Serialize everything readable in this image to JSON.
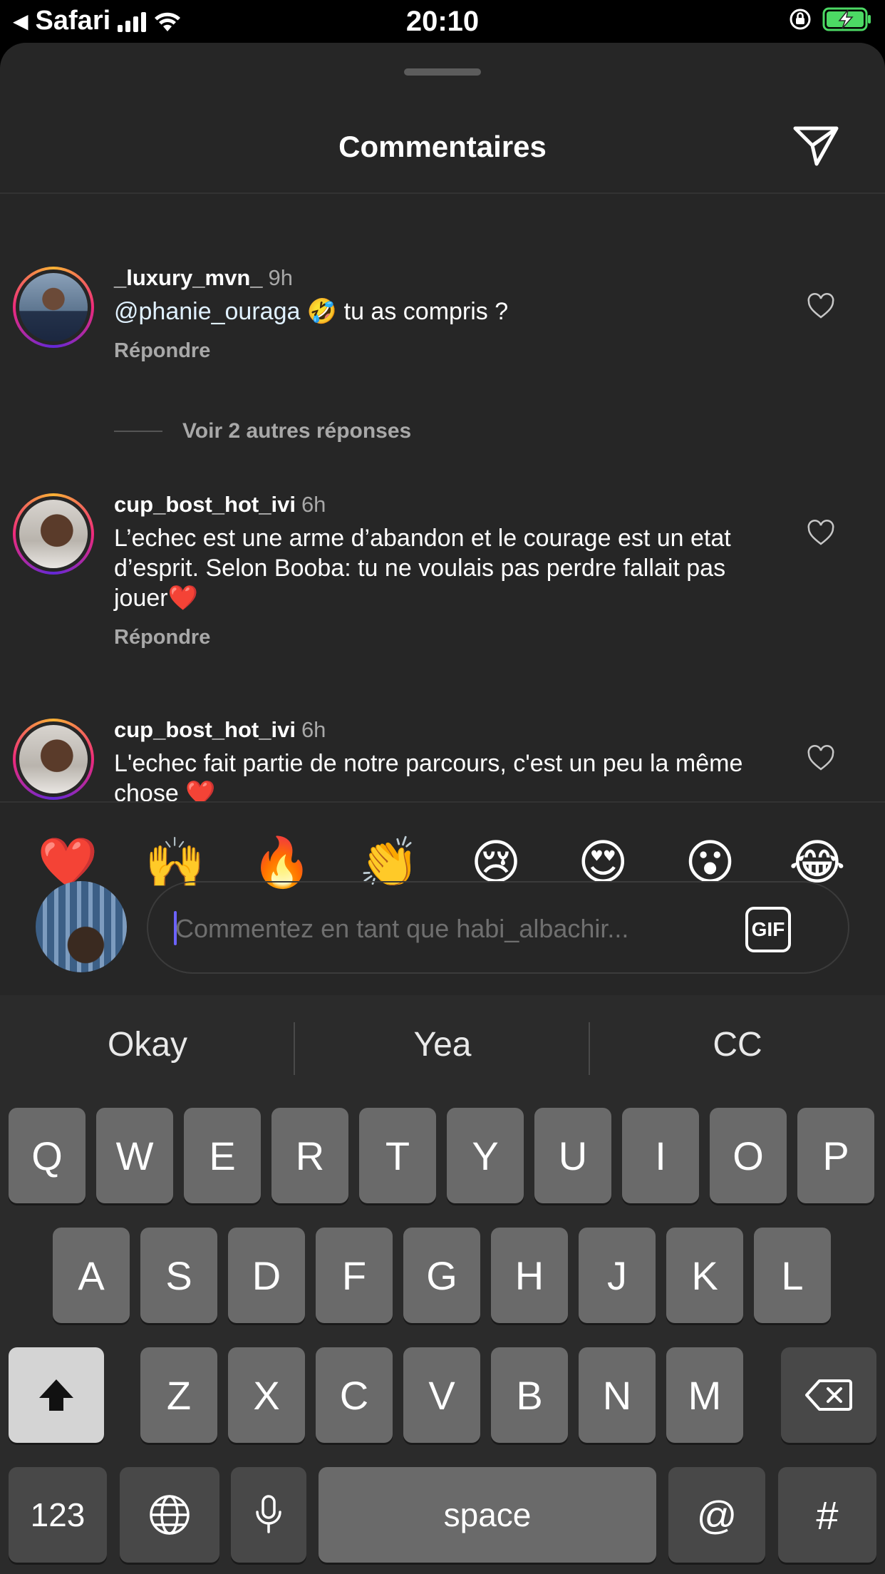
{
  "status_bar": {
    "back_label": "Safari",
    "time": "20:10"
  },
  "sheet": {
    "title": "Commentaires"
  },
  "comments": [
    {
      "username": "_luxury_mvn_",
      "time": "9h",
      "mention": "@phanie_ouraga",
      "text": " 🤣 tu as compris ?",
      "reply_label": "Répondre"
    },
    {
      "username": "cup_bost_hot_ivi",
      "time": "6h",
      "text": "L’echec est une arme d’abandon et le courage est un etat d’esprit. Selon Booba: tu ne voulais pas perdre fallait pas jouer❤️",
      "reply_label": "Répondre"
    },
    {
      "username": "cup_bost_hot_ivi",
      "time": "6h",
      "text": "L'echec fait partie de notre parcours, c'est un peu la même chose ❤️"
    }
  ],
  "more_replies": "Voir 2 autres réponses",
  "quick_emojis": [
    "❤️",
    "🙌",
    "🔥",
    "👏",
    "😢",
    "😍",
    "😮",
    "😂"
  ],
  "comment_input": {
    "placeholder": "Commentez en tant que habi_albachir...",
    "gif_label": "GIF"
  },
  "keyboard": {
    "suggestions": [
      "Okay",
      "Yea",
      "CC"
    ],
    "row1": [
      "Q",
      "W",
      "E",
      "R",
      "T",
      "Y",
      "U",
      "I",
      "O",
      "P"
    ],
    "row2": [
      "A",
      "S",
      "D",
      "F",
      "G",
      "H",
      "J",
      "K",
      "L"
    ],
    "row3": [
      "Z",
      "X",
      "C",
      "V",
      "B",
      "N",
      "M"
    ],
    "numbers_label": "123",
    "space_label": "space",
    "at_label": "@",
    "hash_label": "#"
  },
  "icons": {
    "status": [
      "back-arrow-icon",
      "signal-icon",
      "wifi-icon",
      "rotation-lock-icon",
      "battery-charging-icon"
    ],
    "send": "paper-plane-icon",
    "like": "heart-outline-icon",
    "keyboard": [
      "shift-icon",
      "delete-icon",
      "globe-icon",
      "microphone-icon"
    ]
  },
  "colors": {
    "sheet_bg": "#262626",
    "keyboard_bg": "#2b2b2b",
    "key_bg": "#6a6a6a",
    "muted_text": "#a8a8a8",
    "battery_green": "#4cd964"
  }
}
